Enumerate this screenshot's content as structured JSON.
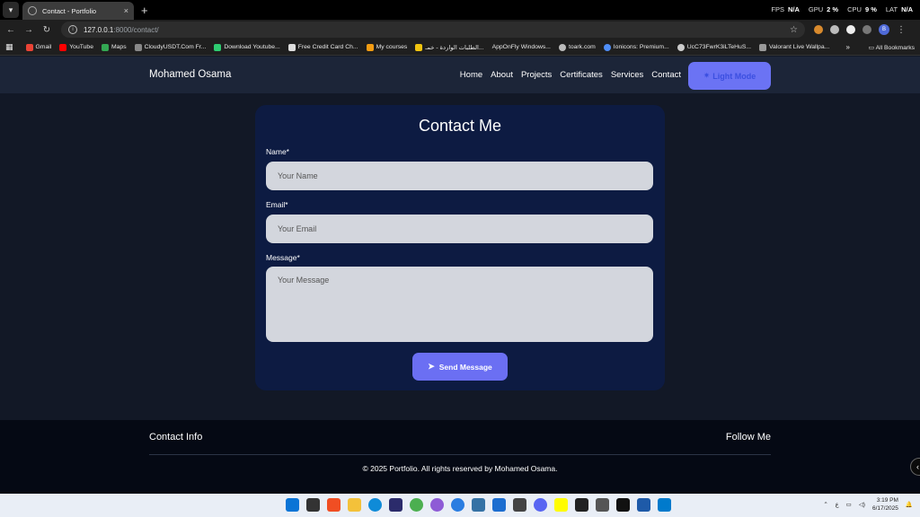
{
  "browser": {
    "tab_title": "Contact - Portfolio",
    "tab_close": "×",
    "new_tab": "+",
    "url_host": "127.0.0.1",
    "url_path": ":8000/contact/",
    "hud": [
      {
        "label": "FPS",
        "value": "N/A"
      },
      {
        "label": "GPU",
        "value": "2 %"
      },
      {
        "label": "CPU",
        "value": "9 %"
      },
      {
        "label": "LAT",
        "value": "N/A"
      }
    ],
    "profile_initial": "B",
    "bookmarks": [
      {
        "label": "Gmail",
        "color": "#ea4335"
      },
      {
        "label": "YouTube",
        "color": "#ff0000"
      },
      {
        "label": "Maps",
        "color": "#34a853"
      },
      {
        "label": "CloudyUSDT.Com Fr...",
        "color": "#888888"
      },
      {
        "label": "Download Youtube...",
        "color": "#2ecc71"
      },
      {
        "label": "Free Credit Card Ch...",
        "color": "#dddddd"
      },
      {
        "label": "My courses",
        "color": "#f39c12"
      },
      {
        "label": "الطلبات الواردة - خمـ...",
        "color": "#f1c40f"
      },
      {
        "label": "AppOnFly Windows...",
        "color": "#1f1f1f"
      },
      {
        "label": "toark.com",
        "color": "#bbbbbb"
      },
      {
        "label": "Ionicons: Premium...",
        "color": "#4f8ef7"
      },
      {
        "label": "UcC73FwrK3iLTeHuS...",
        "color": "#cccccc"
      },
      {
        "label": "Valorant Live Wallpa...",
        "color": "#999999"
      }
    ],
    "bookmarks_more": "»",
    "all_bookmarks": "All Bookmarks"
  },
  "nav": {
    "brand": "Mohamed Osama",
    "links": [
      "Home",
      "About",
      "Projects",
      "Certificates",
      "Services",
      "Contact"
    ],
    "theme_button": "Light Mode"
  },
  "form": {
    "title": "Contact Me",
    "name_label": "Name*",
    "name_placeholder": "Your Name",
    "email_label": "Email*",
    "email_placeholder": "Your Email",
    "message_label": "Message*",
    "message_placeholder": "Your Message",
    "submit": "Send Message"
  },
  "footer": {
    "contact_info": "Contact Info",
    "follow_me": "Follow Me",
    "copyright": "© 2025 Portfolio. All rights reserved by Mohamed Osama."
  },
  "taskbar": {
    "time": "3:19 PM",
    "date": "6/17/2025",
    "lang": "ع"
  },
  "colors": {
    "accent": "#6b6ff3",
    "card_bg": "#0d1b42",
    "page_bg": "#121826",
    "footer_bg": "#050914"
  }
}
